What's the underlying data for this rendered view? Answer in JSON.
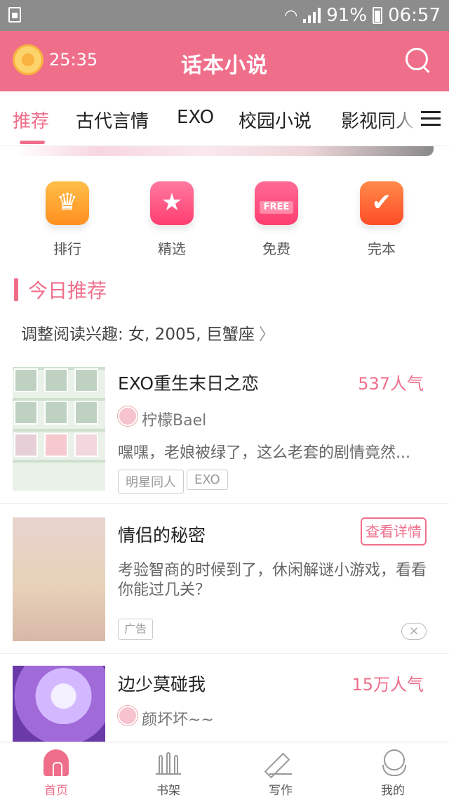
{
  "status_bar": {
    "battery": "91%",
    "time": "06:57"
  },
  "header": {
    "timer": "25:35",
    "title": "话本小说"
  },
  "tabs": [
    "推荐",
    "古代言情",
    "EXO",
    "校园小说",
    "影视同人"
  ],
  "quick_links": [
    {
      "label": "排行",
      "icon": "trophy-icon"
    },
    {
      "label": "精选",
      "icon": "star-icon"
    },
    {
      "label": "免费",
      "icon": "free-icon",
      "badge": "FREE"
    },
    {
      "label": "完本",
      "icon": "check-icon"
    }
  ],
  "section": {
    "title": "今日推荐",
    "preference": "调整阅读兴趣: 女, 2005, 巨蟹座",
    "preference_chevron": "〉"
  },
  "items": [
    {
      "title": "EXO重生末日之恋",
      "popularity": "537人气",
      "author": "柠檬Bael",
      "desc": "嘿嘿，老娘被绿了，这么老套的剧情竟然...",
      "tags": [
        "明星同人",
        "EXO"
      ]
    },
    {
      "ad_title": "情侣的秘密",
      "ad_button": "查看详情",
      "ad_desc": "考验智商的时候到了，休闲解谜小游戏，看看你能过几关？",
      "ad_tag": "广告",
      "ad_close": "×"
    },
    {
      "title": "边少莫碰我",
      "popularity": "15万人气",
      "author": "颜坏坏~~"
    }
  ],
  "bottom_nav": [
    "首页",
    "书架",
    "写作",
    "我的"
  ],
  "colors": {
    "brand": "#ef6f8b",
    "status_bar": "#8c8c8c"
  }
}
